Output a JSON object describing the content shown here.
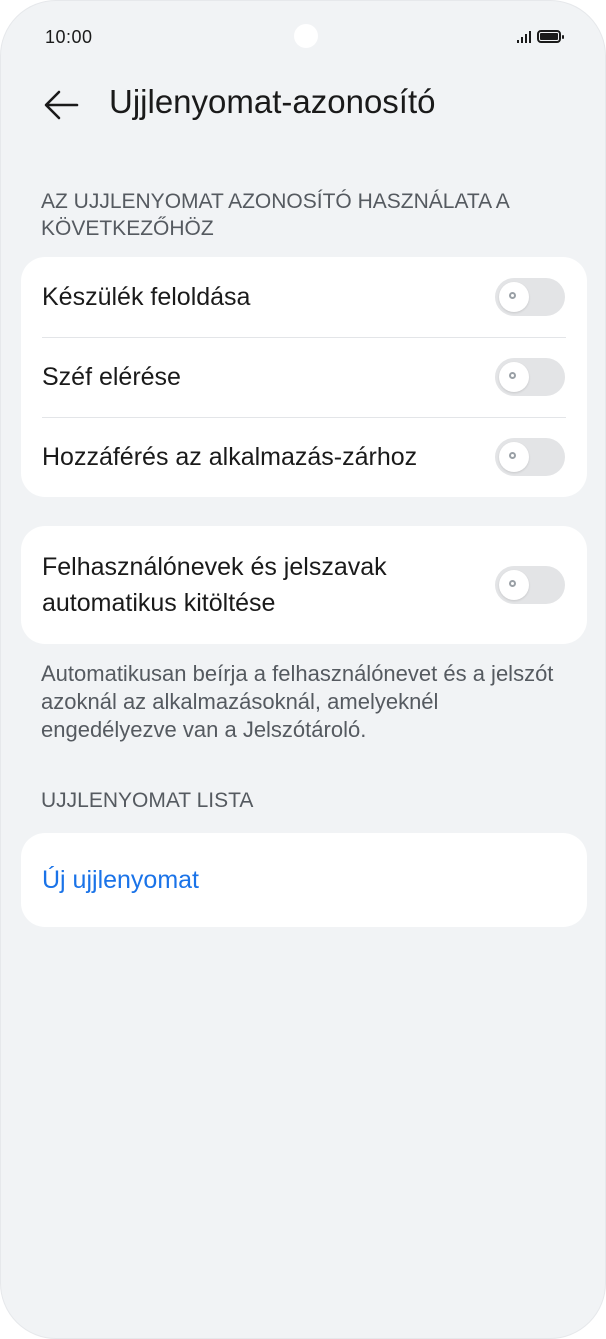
{
  "status_bar": {
    "time": "10:00"
  },
  "header": {
    "title": "Ujjlenyomat-azonosító"
  },
  "section_usage": {
    "label": "AZ UJJLENYOMAT AZONOSÍTÓ HASZNÁLATA A KÖVETKEZŐHÖZ"
  },
  "usage_items": [
    {
      "label": "Készülék feloldása",
      "enabled": false
    },
    {
      "label": "Széf elérése",
      "enabled": false
    },
    {
      "label": "Hozzáférés az alkalmazás-zárhoz",
      "enabled": false
    }
  ],
  "autofill": {
    "label": "Felhasználónevek és jelszavak automatikus kitöltése",
    "enabled": false,
    "description": "Automatikusan beírja a felhasználónevet és a jelszót azoknál az alkalmazásoknál, amelyeknél engedélyezve van a Jelszótároló."
  },
  "section_list": {
    "label": "UJJLENYOMAT LISTA"
  },
  "new_fingerprint": {
    "label": "Új ujjlenyomat"
  },
  "colors": {
    "background": "#f1f3f5",
    "card": "#ffffff",
    "accent": "#1a73e8",
    "toggle_off": "#e3e4e6"
  },
  "icons": {
    "back": "arrow-left-icon",
    "signal": "signal-icon",
    "battery": "battery-icon"
  }
}
